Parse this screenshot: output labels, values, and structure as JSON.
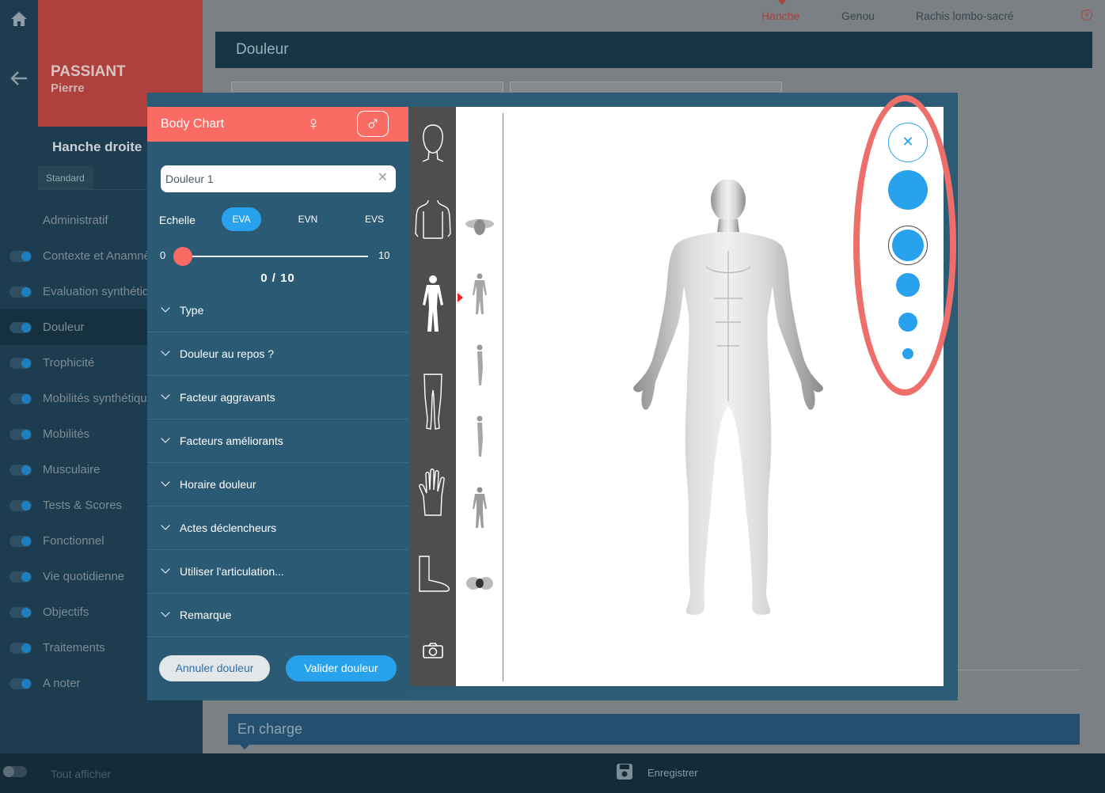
{
  "patient": {
    "last_name": "PASSIANT",
    "first_name": "Pierre"
  },
  "sidebar": {
    "section_title": "Hanche droite",
    "tab_label": "Standard",
    "items": [
      {
        "label": "Administratif",
        "toggle": false,
        "active": false
      },
      {
        "label": "Contexte et Anamnèse",
        "toggle": true,
        "active": false
      },
      {
        "label": "Evaluation synthétique",
        "toggle": true,
        "active": false
      },
      {
        "label": "Douleur",
        "toggle": true,
        "active": true
      },
      {
        "label": "Trophicité",
        "toggle": true,
        "active": false
      },
      {
        "label": "Mobilités synthétiques",
        "toggle": true,
        "active": false
      },
      {
        "label": "Mobilités",
        "toggle": true,
        "active": false
      },
      {
        "label": "Musculaire",
        "toggle": true,
        "active": false
      },
      {
        "label": "Tests & Scores",
        "toggle": true,
        "active": false
      },
      {
        "label": "Fonctionnel",
        "toggle": true,
        "active": false
      },
      {
        "label": "Vie quotidienne",
        "toggle": true,
        "active": false
      },
      {
        "label": "Objectifs",
        "toggle": true,
        "active": false
      },
      {
        "label": "Traitements",
        "toggle": true,
        "active": false
      },
      {
        "label": "A noter",
        "toggle": true,
        "active": false
      }
    ]
  },
  "top_tabs": [
    {
      "label": "Hanche",
      "active": true
    },
    {
      "label": "Genou",
      "active": false
    },
    {
      "label": "Rachis lombo-sacré",
      "active": false
    }
  ],
  "main": {
    "section_title": "Douleur",
    "bottom_section_title": "En charge"
  },
  "footer": {
    "show_all_label": "Tout afficher",
    "save_label": "Enregistrer"
  },
  "modal": {
    "title": "Body Chart",
    "pain_name": "Douleur 1",
    "scale": {
      "label": "Echelle",
      "options": [
        "EVA",
        "EVN",
        "EVS"
      ],
      "selected": "EVA",
      "min_label": "0",
      "max_label": "10",
      "value": 0,
      "max": 10,
      "value_text": "0 / 10"
    },
    "sections": [
      "Type",
      "Douleur au repos ?",
      "Facteur aggravants",
      "Facteurs améliorants",
      "Horaire douleur",
      "Actes déclencheurs",
      "Utiliser l'articulation...",
      "Remarque"
    ],
    "cancel_label": "Annuler douleur",
    "confirm_label": "Valider douleur",
    "views": [
      "head-view-icon",
      "torso-view-icon",
      "full-body-view-icon",
      "legs-view-icon",
      "hand-view-icon",
      "foot-view-icon",
      "camera-icon"
    ],
    "selected_view": "full-body-view-icon"
  },
  "colors": {
    "accent_red": "#fa6b64",
    "accent_blue": "#29a2ee",
    "panel_bg": "#2b5a75",
    "nav_bg": "#1d3c4f"
  }
}
